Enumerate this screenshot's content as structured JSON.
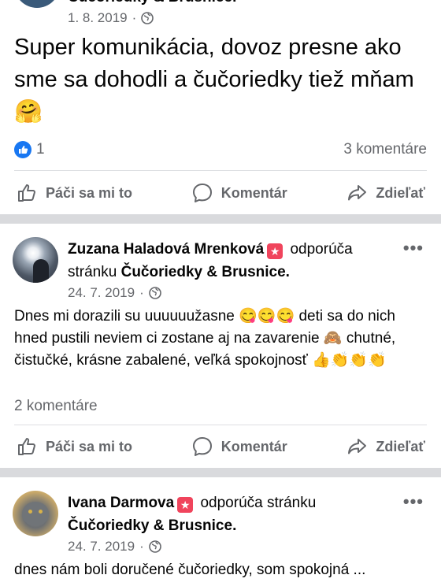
{
  "post1": {
    "date": "1. 8. 2019",
    "text": "Super komunikácia, dovoz presne ako sme sa dohodli a čučoriedky tiež mňam",
    "emoji": "🤗",
    "like_count": "1",
    "comments": "3 komentáre"
  },
  "post2": {
    "author": "Zuzana Haladová Mrenková",
    "verb": "odporúča stránku",
    "page": "Čučoriedky & Brusnice.",
    "date": "24. 7. 2019",
    "text_a": "Dnes mi dorazili su uuuuuužasne",
    "emoji_a": "😋😋😋",
    "text_b": "deti sa do nich hned pustili neviem ci zostane aj na zavarenie",
    "emoji_b": "🙈",
    "text_c": "chutné, čistučké, krásne zabalené, veľká spokojnosť",
    "emoji_c": "👍👏👏👏",
    "comments": "2 komentáre"
  },
  "post3": {
    "author": "Ivana Darmova",
    "verb": "odporúča stránku",
    "page": "Čučoriedky & Brusnice.",
    "date": "24. 7. 2019",
    "text": "dnes nám boli doručené čučoriedky, som spokojná ..."
  },
  "actions": {
    "like": "Páči sa mi to",
    "comment": "Komentár",
    "share": "Zdieľať"
  },
  "more": "•••",
  "colors": {
    "like_blue": "#1877f2",
    "rec_red": "#f0445c",
    "separator": "#d9dadd"
  }
}
